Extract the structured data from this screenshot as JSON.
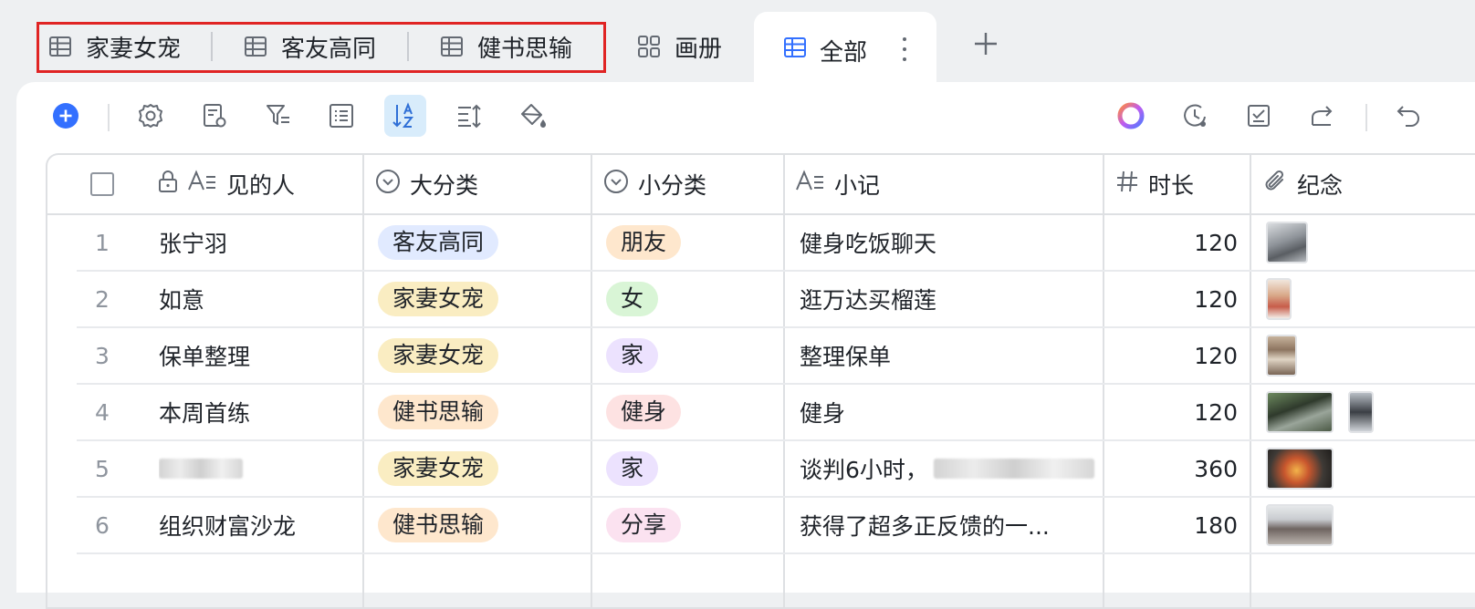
{
  "tabs": [
    {
      "label": "家妻女宠",
      "icon": "table-icon"
    },
    {
      "label": "客友高同",
      "icon": "table-icon"
    },
    {
      "label": "健书思输",
      "icon": "table-icon"
    },
    {
      "label": "画册",
      "icon": "gallery-icon"
    },
    {
      "label": "全部",
      "icon": "table-icon",
      "active": true
    }
  ],
  "add_tab_icon": "plus-icon",
  "toolbar": {
    "left": [
      "add-record-icon",
      "settings-icon",
      "field-settings-icon",
      "filter-icon",
      "group-icon",
      "sort-icon",
      "row-height-icon",
      "fill-color-icon"
    ],
    "right": [
      "ai-assistant-icon",
      "history-icon",
      "task-check-icon",
      "share-icon",
      "undo-icon"
    ]
  },
  "columns": [
    {
      "label": "见的人",
      "icon": "text-field-icon",
      "locked": true
    },
    {
      "label": "大分类",
      "icon": "single-select-icon"
    },
    {
      "label": "小分类",
      "icon": "single-select-icon"
    },
    {
      "label": "小记",
      "icon": "text-field-icon"
    },
    {
      "label": "时长",
      "icon": "number-icon"
    },
    {
      "label": "纪念",
      "icon": "attachment-icon"
    }
  ],
  "rows": [
    {
      "num": "1",
      "person": "张宁羽",
      "category": "客友高同",
      "subcategory": "朋友",
      "note": "健身吃饭聊天",
      "duration": "120"
    },
    {
      "num": "2",
      "person": "如意",
      "category": "家妻女宠",
      "subcategory": "女",
      "note": "逛万达买榴莲",
      "duration": "120"
    },
    {
      "num": "3",
      "person": "保单整理",
      "category": "家妻女宠",
      "subcategory": "家",
      "note": "整理保单",
      "duration": "120"
    },
    {
      "num": "4",
      "person": "本周首练",
      "category": "健书思输",
      "subcategory": "健身",
      "note": "健身",
      "duration": "120"
    },
    {
      "num": "5",
      "person": "",
      "category": "家妻女宠",
      "subcategory": "家",
      "note": "谈判6小时，",
      "duration": "360"
    },
    {
      "num": "6",
      "person": "组织财富沙龙",
      "category": "健书思输",
      "subcategory": "分享",
      "note": "获得了超多正反馈的一...",
      "duration": "180"
    }
  ],
  "colors": {
    "accent": "#3370ff",
    "highlight_border": "#e02424",
    "tag_blue": "#e1eaff",
    "tag_yellow": "#faedc2",
    "tag_orange": "#fee7cd",
    "tag_green": "#d9f5d6",
    "tag_purple": "#ece2fe",
    "tag_red": "#fde2e2",
    "tag_pink": "#fbe2f0"
  }
}
